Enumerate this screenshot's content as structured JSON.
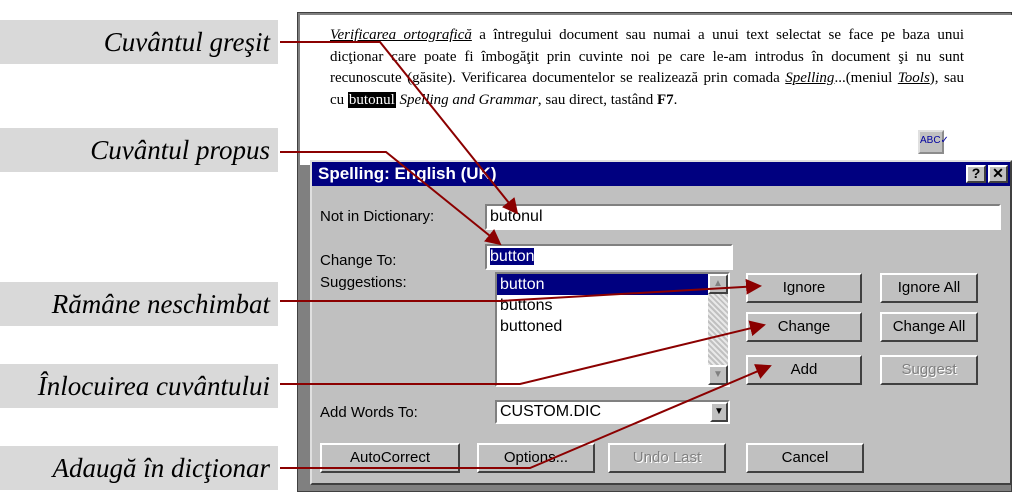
{
  "callouts": {
    "wrong_word": "Cuvântul greşit",
    "proposed_word": "Cuvântul propus",
    "unchanged": "Rămâne neschimbat",
    "replace": "Înlocuirea cuvântului",
    "add_dict": "Adaugă în dicţionar"
  },
  "document": {
    "line1_em": "Verificarea ortografică",
    "line1_rest": " a întregului document sau numai a unui text selectat se face pe baza unui dicţionar care poate fi îmbogăţit prin cuvinte noi pe care le-am introdus în document şi nu sunt recunoscute (găsite).   Verificarea documentelor se realizează prin comada ",
    "spelling_cmd": "Spelling",
    "menu_text": "...(meniul ",
    "tools_menu": "Tools",
    "after_tools": "), sau cu ",
    "selected_word": "butonul",
    "button_name": " Spelling and Grammar",
    "tail": ", sau direct, tastând ",
    "key": "F7",
    "end": "."
  },
  "dialog": {
    "title": "Spelling: English (UK)",
    "help_btn": "?",
    "close_btn": "✕",
    "not_in_dict_label": "Not in Dictionary:",
    "not_in_dict_value": "butonul",
    "change_to_label": "Change To:",
    "change_to_value": "button",
    "suggestions_label": "Suggestions:",
    "suggestions": [
      "button",
      "buttons",
      "buttoned"
    ],
    "add_words_label": "Add Words To:",
    "add_words_value": "CUSTOM.DIC",
    "buttons": {
      "ignore": "Ignore",
      "ignore_all": "Ignore All",
      "change": "Change",
      "change_all": "Change All",
      "add": "Add",
      "suggest": "Suggest",
      "autocorrect": "AutoCorrect",
      "options": "Options...",
      "undo_last": "Undo Last",
      "cancel": "Cancel"
    }
  },
  "colors": {
    "callout_bg": "#d9d9d9",
    "title_bar": "#000080",
    "arrow": "#8b0000",
    "dialog_face": "#c0c0c0"
  }
}
